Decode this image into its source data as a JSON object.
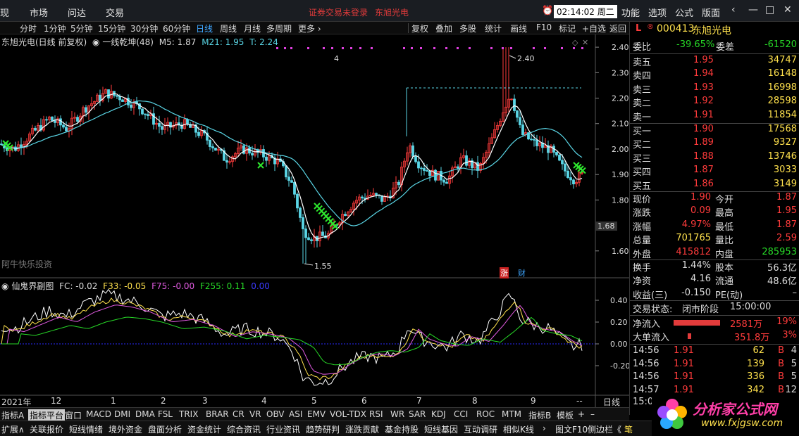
{
  "topbar": {
    "menus": [
      "现",
      "市场",
      "问达",
      "交易"
    ],
    "warning": "证券交易未登录",
    "stock_name": "东旭光电",
    "clock": "02:14:02 周二",
    "right_menus": [
      "功能",
      "选项",
      "公式",
      "版面"
    ],
    "controls": [
      "‹",
      "—",
      "□",
      "✕"
    ]
  },
  "toolbar": {
    "periods": [
      "分时",
      "1分钟",
      "5分钟",
      "15分钟",
      "30分钟",
      "60分钟",
      "日线",
      "周线",
      "月线",
      "多周期",
      "更多 ›"
    ],
    "active_period": "日线",
    "tools": [
      "复权",
      "叠加",
      "多股",
      "统计",
      "画线",
      "F10",
      "标记",
      "+自选",
      "返回"
    ]
  },
  "main_chart": {
    "title": "东旭光电(日线 前复权)",
    "indicator": "一线乾坤(48)",
    "m5": "M5: 1.87",
    "m21": "M21: 1.95",
    "t": "T: 2.24",
    "high_label": "2.40",
    "low_label": "1.55",
    "marker_4": "4",
    "current_price_tag": "1.68",
    "watermark": "阿牛快乐投资",
    "badge_zhang": "涨",
    "badge_cai": "财",
    "y_ticks": [
      "2.40",
      "2.30",
      "2.20",
      "2.10",
      "2.00",
      "1.90",
      "1.80",
      "1.60"
    ]
  },
  "sub_chart": {
    "title": "仙鬼界副图",
    "fc": "FC: -0.02",
    "f33": "F33: -0.05",
    "f75": "F75: -0.00",
    "f255": "F255: 0.11",
    "extra": "0.00",
    "y_ticks": [
      "0.40",
      "0.20",
      "0.00",
      "-0.20"
    ]
  },
  "x_axis": {
    "year": "2021年",
    "months": [
      "12",
      "1",
      "2",
      "3",
      "4",
      "5",
      "6",
      "7",
      "8",
      "9"
    ],
    "right_label": "日线"
  },
  "chart_data": {
    "type": "candlestick",
    "title": "东旭光电(日线 前复权)",
    "ylim": [
      1.5,
      2.45
    ],
    "high": 2.4,
    "low": 1.55,
    "last": 1.9
  },
  "side": {
    "code": "000413",
    "name": "东旭光电",
    "weibi_label": "委比",
    "weibi": "-39.65%",
    "weicha_label": "委差",
    "weicha": "-61520",
    "asks": [
      {
        "label": "卖五",
        "price": "1.95",
        "vol": "34747"
      },
      {
        "label": "卖四",
        "price": "1.94",
        "vol": "16148"
      },
      {
        "label": "卖三",
        "price": "1.93",
        "vol": "16998"
      },
      {
        "label": "卖二",
        "price": "1.92",
        "vol": "28598"
      },
      {
        "label": "卖一",
        "price": "1.91",
        "vol": "11854"
      }
    ],
    "bids": [
      {
        "label": "买一",
        "price": "1.90",
        "vol": "17568"
      },
      {
        "label": "买二",
        "price": "1.89",
        "vol": "9327"
      },
      {
        "label": "买三",
        "price": "1.88",
        "vol": "13746"
      },
      {
        "label": "买四",
        "price": "1.87",
        "vol": "3033"
      },
      {
        "label": "买五",
        "price": "1.86",
        "vol": "3149"
      }
    ],
    "stats": [
      {
        "l1": "现价",
        "v1": "1.90",
        "l2": "今开",
        "v2": "1.87",
        "c1": "#ff3b3b",
        "c2": "#ff3b3b"
      },
      {
        "l1": "涨跌",
        "v1": "0.09",
        "l2": "最高",
        "v2": "1.95",
        "c1": "#ff3b3b",
        "c2": "#ff3b3b"
      },
      {
        "l1": "涨幅",
        "v1": "4.97%",
        "l2": "最低",
        "v2": "1.87",
        "c1": "#ff3b3b",
        "c2": "#ff3b3b"
      },
      {
        "l1": "总量",
        "v1": "701765",
        "l2": "量比",
        "v2": "2.59",
        "c1": "#ffe14d",
        "c2": "#ff3b3b"
      },
      {
        "l1": "外盘",
        "v1": "415812",
        "l2": "内盘",
        "v2": "285953",
        "c1": "#ff3b3b",
        "c2": "#27d927"
      }
    ],
    "stats2": [
      {
        "l1": "换手",
        "v1": "1.44%",
        "l2": "股本",
        "v2": "56.3亿"
      },
      {
        "l1": "净资",
        "v1": "4.16",
        "l2": "流通",
        "v2": "48.6亿"
      },
      {
        "l1": "收益(三)",
        "v1": "-0.150",
        "l2": "PE(动)",
        "v2": "–"
      }
    ],
    "trade_state_label": "交易状态:",
    "trade_state": "闭市阶段",
    "trade_time": "15:00:00",
    "net_in_label": "净流入",
    "net_in": "2581万",
    "net_in_pct": "19%",
    "big_in_label": "大单流入",
    "big_in": "351.8万",
    "big_in_pct": "3%",
    "ticks": [
      {
        "t": "14:56",
        "p": "1.91",
        "v": "62",
        "s": "B",
        "n": "4"
      },
      {
        "t": "14:56",
        "p": "1.91",
        "v": "139",
        "s": "B",
        "n": "5"
      },
      {
        "t": "14:56",
        "p": "1.91",
        "v": "336",
        "s": "B",
        "n": "5"
      },
      {
        "t": "14:57",
        "p": "1.91",
        "v": "342",
        "s": "B",
        "n": "12"
      }
    ],
    "last_time": "15:0"
  },
  "bottom_tabs": [
    "指标A",
    "指标平台",
    "窗口",
    "MACD",
    "DMI",
    "DMA",
    "FSL",
    "TRIX",
    "BRAR",
    "CR",
    "VR",
    "OBV",
    "ASI",
    "EMV",
    "VOL-TDX",
    "RSI",
    "WR",
    "SAR",
    "KDJ",
    "CCI",
    "ROC",
    "MTM",
    "指标B",
    "模板",
    "+",
    "–"
  ],
  "bottom_tabs_active": "指标平台",
  "bottom_bar": [
    "扩展∧",
    "关联报价",
    "短线情绪",
    "境外资金",
    "盘面分析",
    "资金统计",
    "综合资讯",
    "行业资讯",
    "趋势研判",
    "涨跌贡献",
    "基金持股",
    "短线基因",
    "互动调研",
    "相似K线",
    "›",
    "图文F10",
    "侧边栏《",
    "笔"
  ],
  "logo": {
    "text": "分析家公式网",
    "url": "www.fxjgsw.com"
  }
}
